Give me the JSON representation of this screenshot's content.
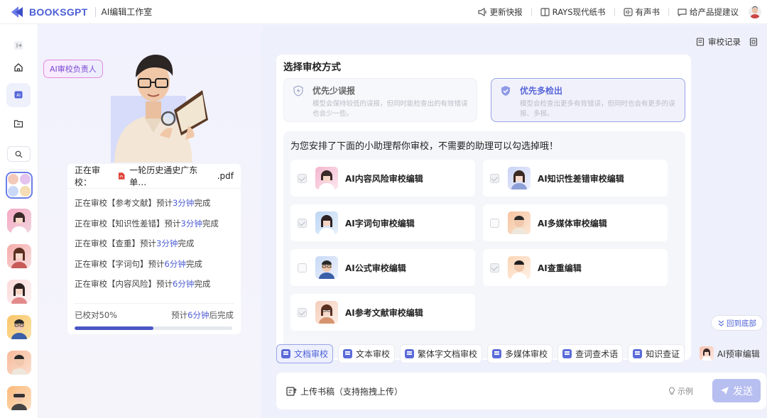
{
  "header": {
    "brand": "BOOKSGPT",
    "studio": "AI编辑工作室",
    "actions": [
      {
        "icon": "megaphone-icon",
        "label": "更新快报"
      },
      {
        "icon": "book-icon",
        "label": "RAYS现代纸书"
      },
      {
        "icon": "audiobook-icon",
        "label": "有声书"
      },
      {
        "icon": "chat-icon",
        "label": "给产品提建议"
      }
    ]
  },
  "left_panel": {
    "badge": "AI审校负责人",
    "current_label": "正在审校：",
    "file_name": "一轮历史通史广东单…",
    "file_ext": ".pdf",
    "tasks": [
      {
        "prefix": "正在审校【参考文献】预计",
        "time": "3分钟",
        "suffix": "完成"
      },
      {
        "prefix": "正在审校【知识性差错】预计",
        "time": "3分钟",
        "suffix": "完成"
      },
      {
        "prefix": "正在审校【查重】预计",
        "time": "3分钟",
        "suffix": "完成"
      },
      {
        "prefix": "正在审校【字词句】预计",
        "time": "6分钟",
        "suffix": "完成"
      },
      {
        "prefix": "正在审校【内容风险】预计",
        "time": "6分钟",
        "suffix": "完成"
      }
    ],
    "progress_text": "已校对50%",
    "progress_value": 0.5,
    "eta_prefix": "预计",
    "eta_time": "6分钟",
    "eta_suffix": "后完成"
  },
  "main": {
    "audit_record": "审校记录",
    "method_title": "选择审校方式",
    "options": [
      {
        "title": "优先少误报",
        "desc": "模型会保持较低的误报，但同时能检查出的有效错误也会少一些。",
        "selected": false
      },
      {
        "title": "优先多检出",
        "desc": "模型会检查出更多有效错误，但同时也会有更多的误报、多报。",
        "selected": true
      }
    ],
    "assist_title": "为您安排了下面的小助理帮你审校，不需要的助理可以勾选掉哦！",
    "assistants": [
      {
        "name": "AI内容风险审校编辑",
        "checked": true
      },
      {
        "name": "AI知识性差错审校编辑",
        "checked": true
      },
      {
        "name": "AI字词句审校编辑",
        "checked": true
      },
      {
        "name": "AI多媒体审校编辑",
        "checked": false
      },
      {
        "name": "AI公式审校编辑",
        "checked": false
      },
      {
        "name": "AI查重编辑",
        "checked": true
      },
      {
        "name": "AI参考文献审校编辑",
        "checked": true
      }
    ],
    "back_to_bottom": "回到底部",
    "tools": [
      {
        "label": "文档审校",
        "active": true
      },
      {
        "label": "文本审校",
        "active": false
      },
      {
        "label": "繁体字文档审校",
        "active": false
      },
      {
        "label": "多媒体审校",
        "active": false
      },
      {
        "label": "查词查术语",
        "active": false
      },
      {
        "label": "知识查证",
        "active": false
      }
    ],
    "ai_pre_edit": "AI预审编辑",
    "upload_label": "上传书稿（支持拖拽上传）",
    "example_label": "示例",
    "send_label": "发送"
  },
  "colors": {
    "accent": "#4b5fd6",
    "progress": "#4b56c4",
    "send": "#b7bef0"
  }
}
